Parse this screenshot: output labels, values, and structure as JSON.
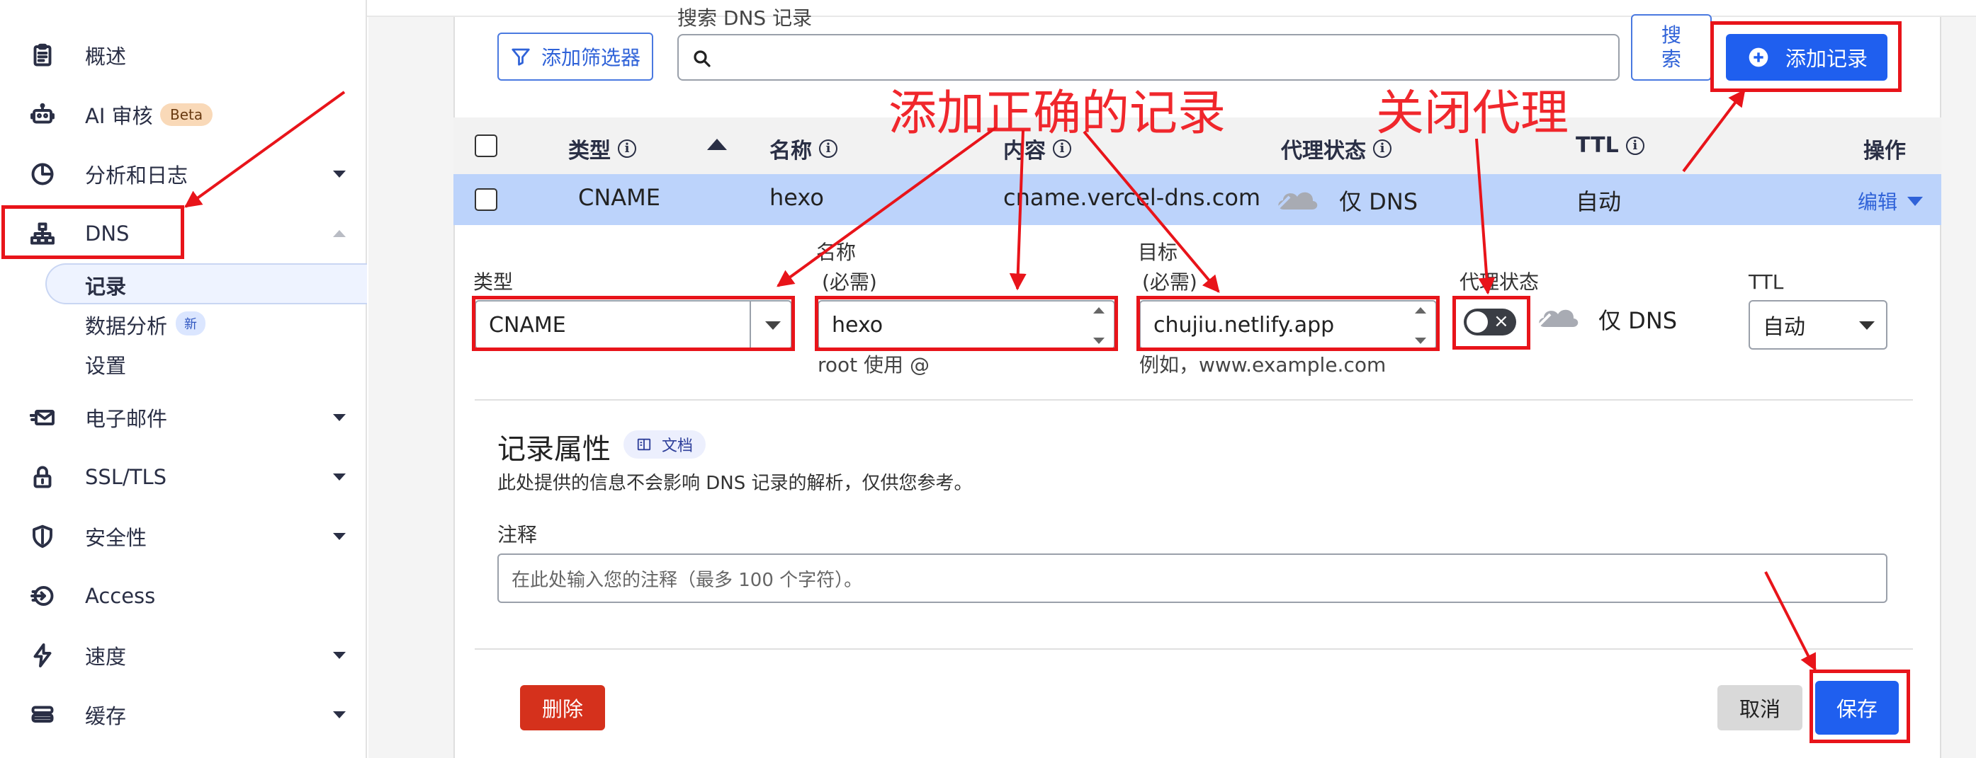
{
  "sidebar": {
    "items": [
      {
        "label": "概述",
        "icon": "clipboard-icon",
        "expandable": false
      },
      {
        "label": "AI 审核",
        "icon": "robot-icon",
        "badge": "Beta",
        "expandable": false
      },
      {
        "label": "分析和日志",
        "icon": "pie-chart-icon",
        "expandable": true
      },
      {
        "label": "DNS",
        "icon": "sitemap-icon",
        "expandable": true,
        "expanded": true
      },
      {
        "label": "电子邮件",
        "icon": "email-icon",
        "expandable": true
      },
      {
        "label": "SSL/TLS",
        "icon": "lock-icon",
        "expandable": true
      },
      {
        "label": "安全性",
        "icon": "shield-icon",
        "expandable": true
      },
      {
        "label": "Access",
        "icon": "access-icon",
        "expandable": false
      },
      {
        "label": "速度",
        "icon": "lightning-icon",
        "expandable": true
      },
      {
        "label": "缓存",
        "icon": "stack-icon",
        "expandable": true
      }
    ],
    "dns_sub": [
      {
        "label": "记录",
        "active": true
      },
      {
        "label": "数据分析",
        "badge": "新"
      },
      {
        "label": "设置"
      }
    ]
  },
  "toolbar": {
    "filter_label": "添加筛选器",
    "search_label": "搜索 DNS 记录",
    "search_value": "",
    "search_button": "搜索",
    "add_record": "添加记录"
  },
  "table": {
    "columns": [
      "类型",
      "名称",
      "内容",
      "代理状态",
      "TTL",
      "操作"
    ],
    "row": {
      "type": "CNAME",
      "name": "hexo",
      "content": "cname.vercel-dns.com",
      "proxy": "仅 DNS",
      "ttl": "自动",
      "action": "编辑"
    }
  },
  "form": {
    "type_label": "类型",
    "type_value": "CNAME",
    "name_label": "名称",
    "name_required": "(必需)",
    "name_value": "hexo",
    "name_hint": "root 使用 @",
    "target_label": "目标",
    "target_required": "(必需)",
    "target_value": "chujiu.netlify.app",
    "target_hint": "例如，www.example.com",
    "proxy_label": "代理状态",
    "proxy_value": "仅 DNS",
    "proxy_on": false,
    "ttl_label": "TTL",
    "ttl_value": "自动",
    "attr_title": "记录属性",
    "docs_label": "文档",
    "attr_desc": "此处提供的信息不会影响 DNS 记录的解析，仅供您参考。",
    "comment_label": "注释",
    "comment_placeholder": "在此处输入您的注释（最多 100 个字符）。",
    "delete_button": "删除",
    "cancel_button": "取消",
    "save_button": "保存"
  },
  "annotations": {
    "add_correct_record": "添加正确的记录",
    "close_proxy": "关闭代理"
  },
  "colors": {
    "primary": "#1f5fef",
    "danger": "#d5311c",
    "annotation": "#e8141a",
    "row_highlight": "#bcd3fb"
  }
}
